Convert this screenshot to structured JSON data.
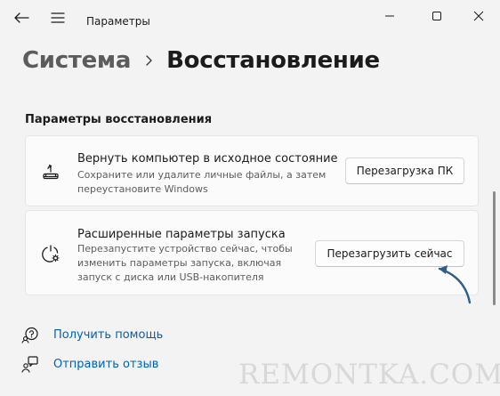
{
  "titlebar": {
    "title": "Параметры",
    "back_icon": "back-arrow-icon",
    "menu_icon": "hamburger-menu-icon"
  },
  "breadcrumb": {
    "parent": "Система",
    "current": "Восстановление"
  },
  "section": {
    "title": "Параметры восстановления"
  },
  "cards": [
    {
      "icon": "reset-pc-icon",
      "title": "Вернуть компьютер в исходное состояние",
      "desc_lines": [
        "Сохраните или удалите личные файлы, а затем",
        "переустановите Windows"
      ],
      "button": "Перезагрузка ПК"
    },
    {
      "icon": "advanced-startup-icon",
      "title": "Расширенные параметры запуска",
      "desc_lines": [
        "Перезапустите устройство сейчас, чтобы",
        "изменить параметры запуска, включая",
        "запуск с диска или USB-накопителя"
      ],
      "button": "Перезагрузить сейчас"
    }
  ],
  "links": {
    "help": "Получить помощь",
    "feedback": "Отправить отзыв"
  },
  "watermark": "REMONTKA.COM",
  "colors": {
    "background": "#f3f3f3",
    "card": "#fbfbfb",
    "link": "#0060b8",
    "arrow": "#2e5f8c"
  }
}
